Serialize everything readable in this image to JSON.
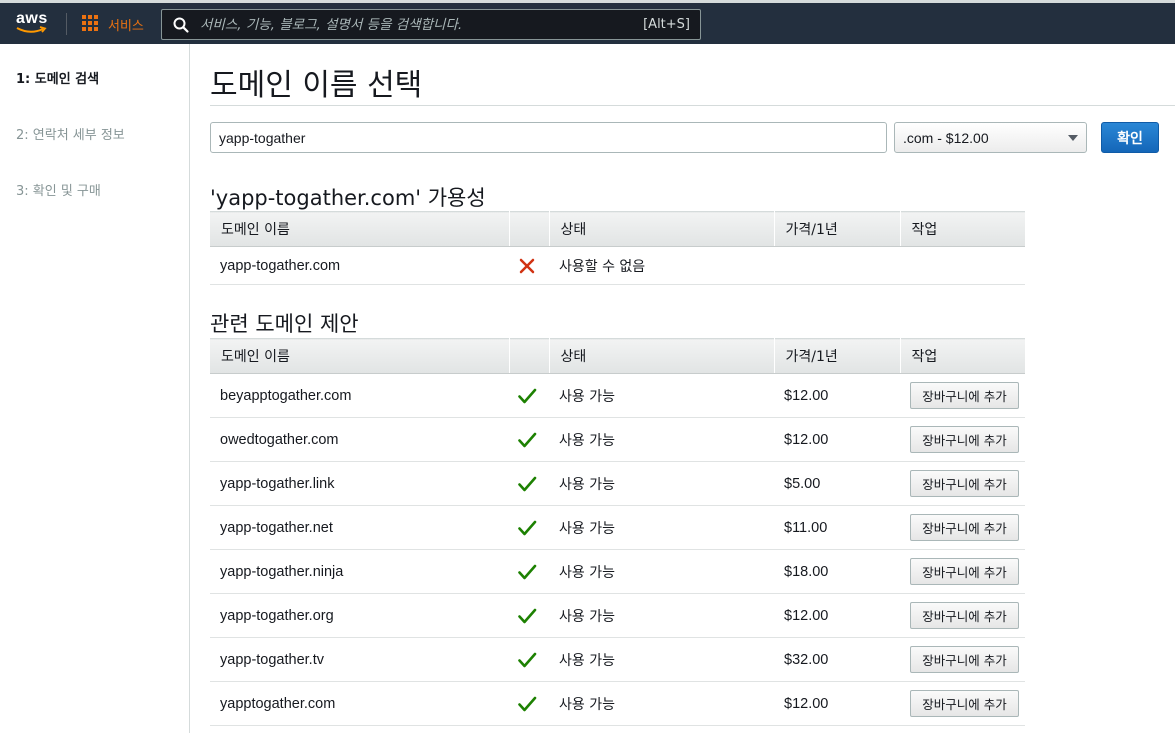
{
  "nav": {
    "logo": "aws",
    "services_label": "서비스",
    "search_placeholder": "서비스, 기능, 블로그, 설명서 등을 검색합니다.",
    "search_shortcut": "[Alt+S]"
  },
  "sidebar": {
    "steps": [
      {
        "label": "1: 도메인 검색",
        "active": true
      },
      {
        "label": "2: 연락처 세부 정보",
        "active": false
      },
      {
        "label": "3: 확인 및 구매",
        "active": false
      }
    ]
  },
  "main": {
    "title": "도메인 이름 선택",
    "search_value": "yapp-togather",
    "tld_selected": ".com - $12.00",
    "confirm_label": "확인",
    "availability_title": "'yapp-togather.com' 가용성",
    "suggestions_title": "관련 도메인 제안",
    "columns": {
      "name": "도메인 이름",
      "icon": "",
      "status": "상태",
      "price": "가격/1년",
      "action": "작업"
    },
    "availability": {
      "name": "yapp-togather.com",
      "icon": "x-mark-icon",
      "status": "사용할 수 없음",
      "price": ""
    },
    "add_to_cart_label": "장바구니에 추가",
    "suggestions": [
      {
        "name": "beyapptogather.com",
        "status": "사용 가능",
        "price": "$12.00"
      },
      {
        "name": "owedtogather.com",
        "status": "사용 가능",
        "price": "$12.00"
      },
      {
        "name": "yapp-togather.link",
        "status": "사용 가능",
        "price": "$5.00"
      },
      {
        "name": "yapp-togather.net",
        "status": "사용 가능",
        "price": "$11.00"
      },
      {
        "name": "yapp-togather.ninja",
        "status": "사용 가능",
        "price": "$18.00"
      },
      {
        "name": "yapp-togather.org",
        "status": "사용 가능",
        "price": "$12.00"
      },
      {
        "name": "yapp-togather.tv",
        "status": "사용 가능",
        "price": "$32.00"
      },
      {
        "name": "yapptogather.com",
        "status": "사용 가능",
        "price": "$12.00"
      }
    ]
  },
  "colors": {
    "nav_bg": "#232f3e",
    "accent_orange": "#ec7211",
    "primary_blue": "#1466b8",
    "available_green": "#1d8102",
    "unavailable_red": "#d13212"
  }
}
